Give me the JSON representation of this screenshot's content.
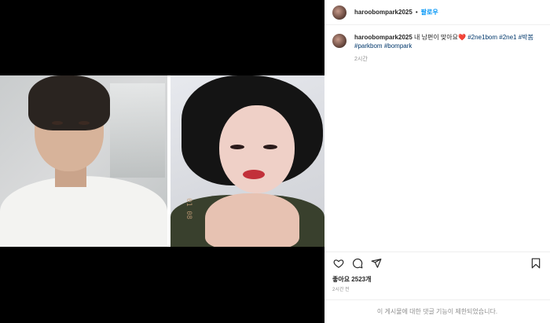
{
  "post": {
    "username": "haroobompark2025",
    "separator": "•",
    "follow_label": "팔로우",
    "caption": {
      "username": "haroobompark2025",
      "text": " 내 남편이 맞아요",
      "heart": "❤️",
      "hashtags": [
        "#2ne1bom",
        "#2ne1",
        "#박봄",
        "#parkbom",
        "#bompark"
      ],
      "time": "2시간"
    },
    "likes": "좋아요 2523개",
    "time": "2시간 전",
    "comments_restricted": "이 게시물에 대한 댓글 기능이 제한되었습니다."
  },
  "media": {
    "date_stamp": "01 08"
  },
  "icons": {
    "like": "heart-icon",
    "comment": "comment-icon",
    "share": "send-icon",
    "save": "bookmark-icon"
  },
  "colors": {
    "link_blue": "#0095f6",
    "hashtag": "#00376b",
    "muted": "#8e8e8e"
  }
}
